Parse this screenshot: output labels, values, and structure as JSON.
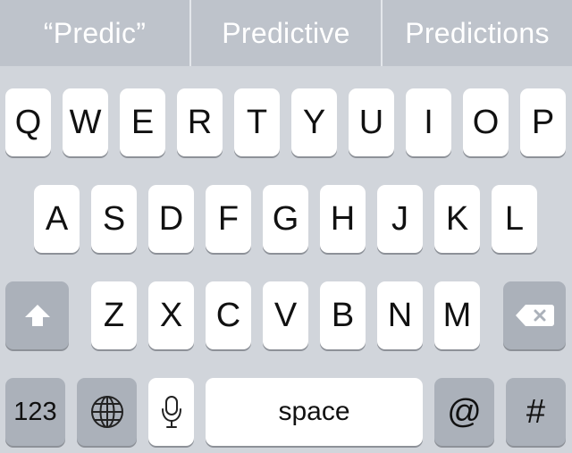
{
  "predictions": [
    "“Predic”",
    "Predictive",
    "Predictions"
  ],
  "keyboard": {
    "row1": [
      "Q",
      "W",
      "E",
      "R",
      "T",
      "Y",
      "U",
      "I",
      "O",
      "P"
    ],
    "row2": [
      "A",
      "S",
      "D",
      "F",
      "G",
      "H",
      "J",
      "K",
      "L"
    ],
    "row3": [
      "Z",
      "X",
      "C",
      "V",
      "B",
      "N",
      "M"
    ],
    "bottom": {
      "numbers_label": "123",
      "space_label": "space",
      "at_label": "@",
      "hash_label": "#"
    }
  },
  "icons": {
    "shift": "shift-icon",
    "backspace": "backspace-icon",
    "globe": "globe-icon",
    "microphone": "microphone-icon"
  }
}
